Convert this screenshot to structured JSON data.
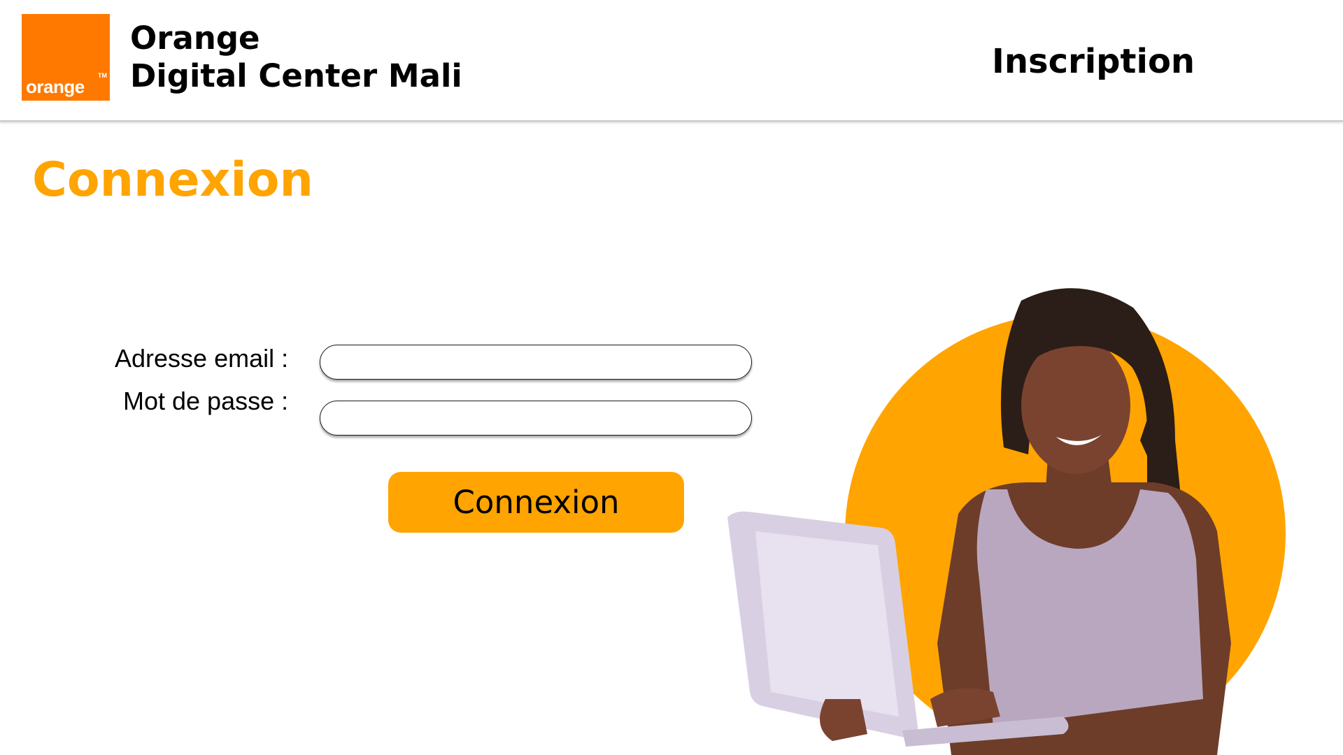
{
  "header": {
    "logo_text": "orange",
    "logo_tm": "TM",
    "brand_line1": "Orange",
    "brand_line2": "Digital Center Mali",
    "nav_inscription": "Inscription"
  },
  "main": {
    "title": "Connexion",
    "form": {
      "email_label": "Adresse email :",
      "email_value": "",
      "password_label": "Mot de passe :",
      "password_value": "",
      "submit_label": "Connexion"
    }
  },
  "colors": {
    "brand_orange": "#ff7900",
    "accent": "#ffa400",
    "text": "#000000"
  }
}
